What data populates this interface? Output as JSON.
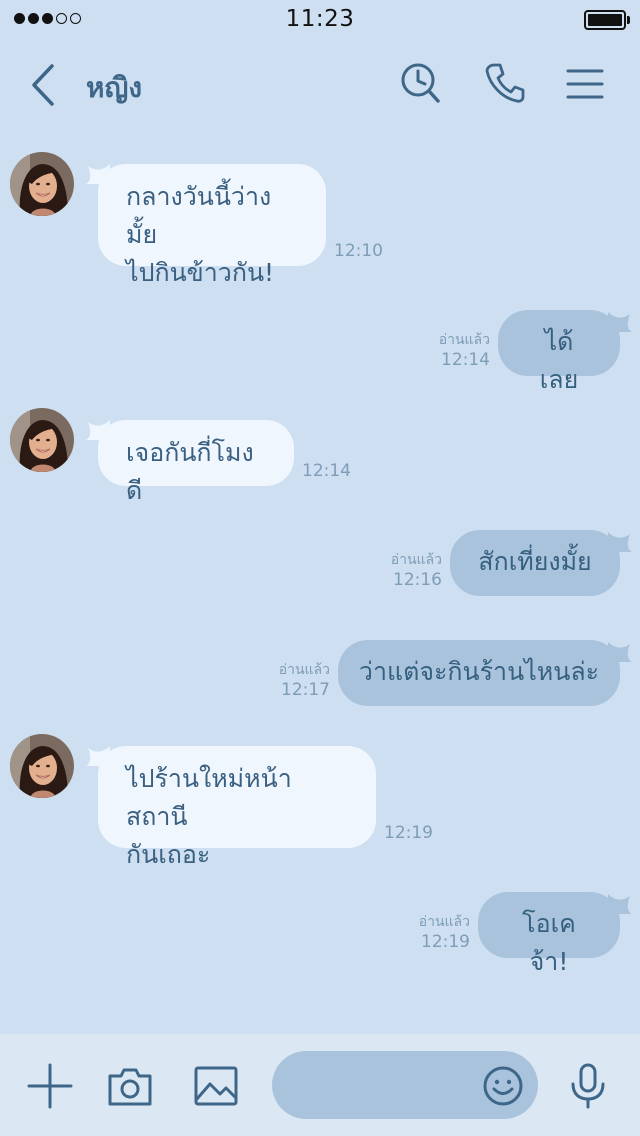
{
  "status_bar": {
    "time": "11:23",
    "signal_filled": 3,
    "signal_total": 5
  },
  "header": {
    "title": "หญิง",
    "icons": [
      "back-chevron-icon",
      "search-clock-icon",
      "phone-icon",
      "menu-icon"
    ]
  },
  "messages": [
    {
      "direction": "in",
      "lines": [
        "กลางวันนี้ว่างมั้ย",
        "ไปกินข้าวกัน!"
      ],
      "time": "12:10"
    },
    {
      "direction": "out",
      "text": "ได้เลย",
      "read": "อ่านแล้ว",
      "time": "12:14"
    },
    {
      "direction": "in",
      "lines": [
        "เจอกันกี่โมงดี"
      ],
      "time": "12:14"
    },
    {
      "direction": "out",
      "text": "สักเที่ยงมั้ย",
      "read": "อ่านแล้ว",
      "time": "12:16"
    },
    {
      "direction": "out",
      "text": "ว่าแต่จะกินร้านไหนล่ะ",
      "read": "อ่านแล้ว",
      "time": "12:17"
    },
    {
      "direction": "in",
      "lines": [
        "ไปร้านใหม่หน้าสถานี",
        "กันเถอะ"
      ],
      "time": "12:19"
    },
    {
      "direction": "out",
      "text": "โอเคจ้า!",
      "read": "อ่านแล้ว",
      "time": "12:19"
    }
  ],
  "input_bar": {
    "message_value": "",
    "icons": [
      "plus-icon",
      "camera-icon",
      "image-icon",
      "emoji-icon",
      "microphone-icon"
    ]
  },
  "colors": {
    "background": "#cddff0",
    "incoming_bubble": "#eff6fd",
    "outgoing_bubble": "#a9c3dc",
    "accent": "#3e6688"
  }
}
